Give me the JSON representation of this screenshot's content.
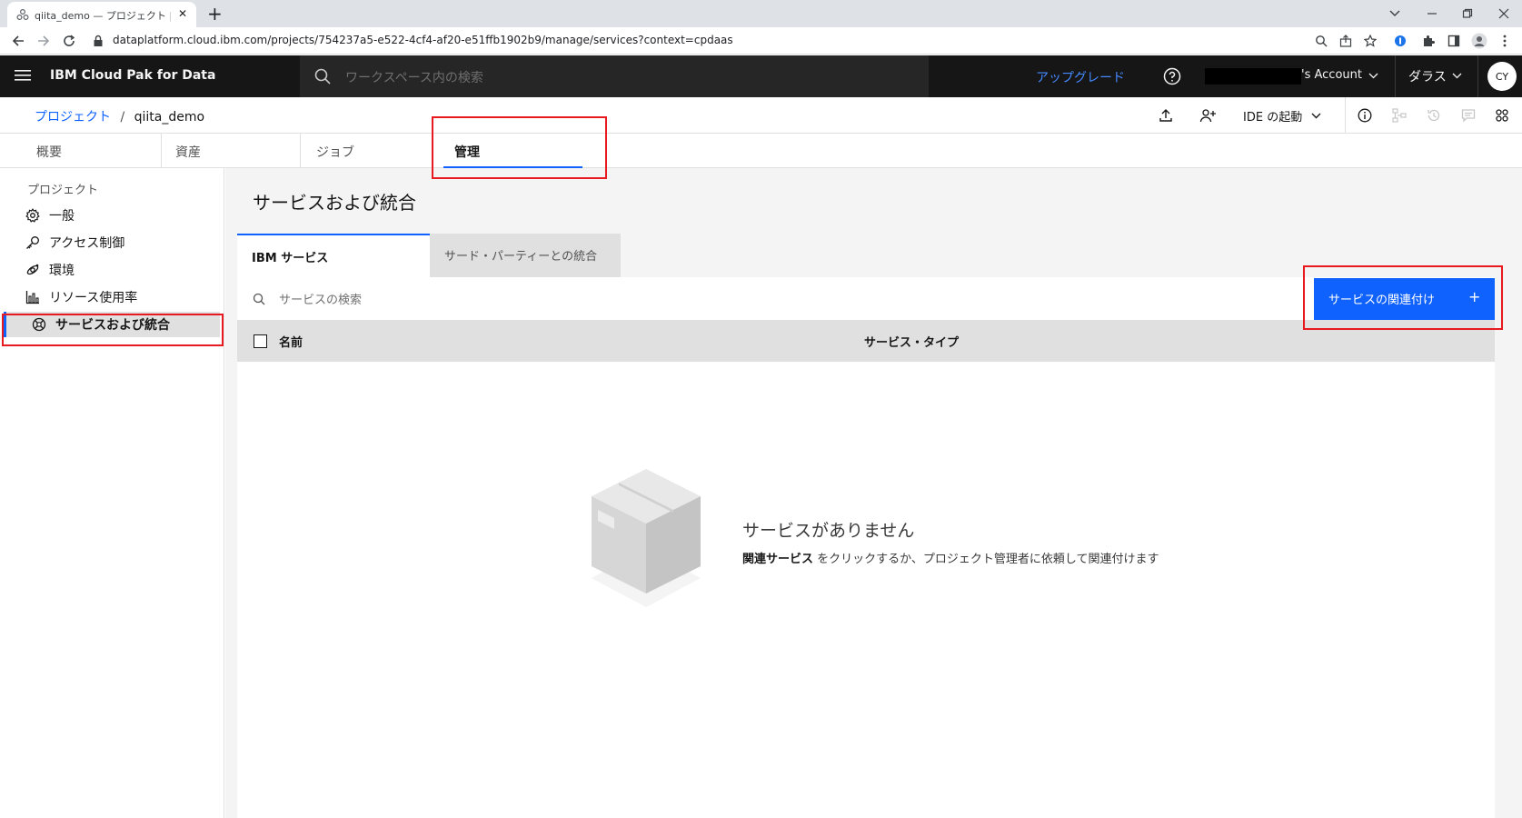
{
  "browser": {
    "tab_title": "qiita_demo — プロジェクト | IBM Cl",
    "tab_close": "✕",
    "new_tab": "+",
    "url": "dataplatform.cloud.ibm.com/projects/754237a5-e522-4cf4-af20-e51ffb1902b9/manage/services?context=cpdaas"
  },
  "header": {
    "brand": "IBM Cloud Pak for Data",
    "search_placeholder": "ワークスペース内の検索",
    "upgrade": "アップグレード",
    "account": "'s Account",
    "region": "ダラス",
    "avatar": "CY"
  },
  "breadcrumb": {
    "project": "プロジェクト",
    "separator": "/",
    "current": "qiita_demo"
  },
  "toolbar": {
    "launch_ide": "IDE の起動"
  },
  "project_tabs": [
    {
      "label": "概要"
    },
    {
      "label": "資産"
    },
    {
      "label": "ジョブ"
    },
    {
      "label": "管理"
    }
  ],
  "sidebar": {
    "heading": "プロジェクト",
    "items": [
      {
        "label": "一般",
        "icon": "gear-icon"
      },
      {
        "label": "アクセス制御",
        "icon": "key-icon"
      },
      {
        "label": "環境",
        "icon": "environment-icon"
      },
      {
        "label": "リソース使用率",
        "icon": "bar-chart-icon"
      },
      {
        "label": "サービスおよび統合",
        "icon": "integration-icon",
        "selected": true
      }
    ]
  },
  "main": {
    "title": "サービスおよび統合",
    "tabs": [
      {
        "label": "IBM サービス",
        "selected": true
      },
      {
        "label": "サード・パーティーとの統合"
      }
    ],
    "search_placeholder": "サービスの検索",
    "associate_button": "サービスの関連付け",
    "associate_plus": "+",
    "table": {
      "columns": [
        "名前",
        "サービス・タイプ"
      ]
    },
    "empty_state": {
      "title": "サービスがありません",
      "link_text": "関連サービス",
      "message": " をクリックするか、プロジェクト管理者に依頼して関連付けます"
    }
  },
  "colors": {
    "ibm_blue": "#0f62fe",
    "header_bg": "#161616",
    "highlight_red": "#e8191f"
  }
}
